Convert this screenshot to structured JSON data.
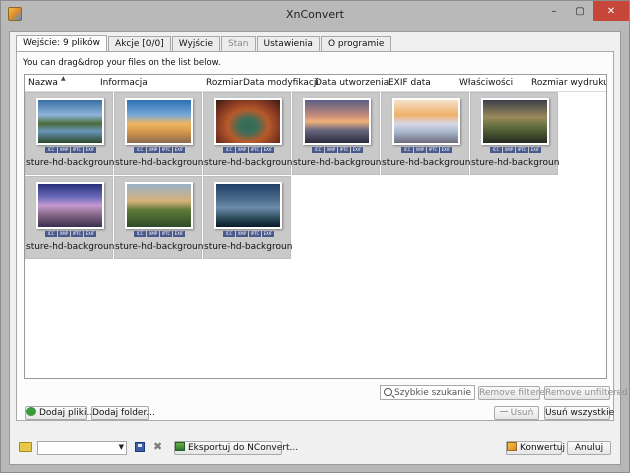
{
  "window": {
    "title": "XnConvert",
    "minimize": "–",
    "maximize": "▢",
    "close": "✕"
  },
  "tabs": [
    {
      "label": "Wejście: 9 plików",
      "active": true
    },
    {
      "label": "Akcje [0/0]"
    },
    {
      "label": "Wyjście"
    },
    {
      "label": "Stan",
      "disabled": true
    },
    {
      "label": "Ustawienia"
    },
    {
      "label": "O programie"
    }
  ],
  "panel": {
    "hint": "You can drag&drop your files on the list below."
  },
  "columns": [
    "Nazwa",
    "Informacja",
    "Rozmiar",
    "Data modyfikacji",
    "Data utworzenia",
    "EXIF data",
    "Właściwości",
    "Rozmiar wydruku"
  ],
  "sort_arrow": "▲",
  "badges": [
    "ICC",
    "XMP",
    "IPTC",
    "EXIF"
  ],
  "files": [
    {
      "name": "sture-hd-background-"
    },
    {
      "name": "sture-hd-background-"
    },
    {
      "name": "sture-hd-background-"
    },
    {
      "name": "sture-hd-background-"
    },
    {
      "name": "sture-hd-background-"
    },
    {
      "name": "sture-hd-background-"
    },
    {
      "name": "sture-hd-background-"
    },
    {
      "name": "sture-hd-background-"
    },
    {
      "name": "sture-hd-background-"
    }
  ],
  "filter": {
    "search_placeholder": "Szybkie szukanie",
    "remove_filtered": "Remove filtered",
    "remove_unfiltered": "Remove unfiltered"
  },
  "actions": {
    "add_files": "Dodaj pliki...",
    "add_folder": "Dodaj folder...",
    "remove": "Usuń",
    "remove_all": "Usuń wszystkie"
  },
  "bottom": {
    "preset_value": "",
    "export": "Eksportuj do NConvert...",
    "convert": "Konwertuj",
    "cancel": "Anuluj"
  }
}
